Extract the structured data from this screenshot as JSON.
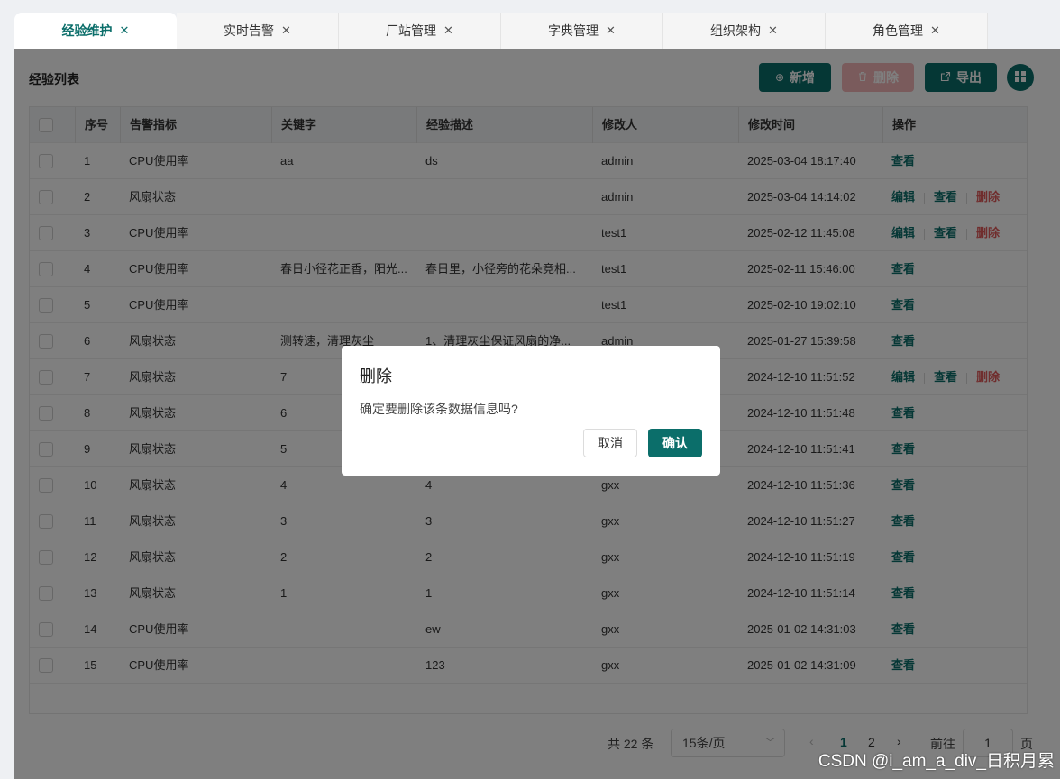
{
  "tabs": [
    {
      "label": "经验维护",
      "active": true
    },
    {
      "label": "实时告警"
    },
    {
      "label": "厂站管理"
    },
    {
      "label": "字典管理"
    },
    {
      "label": "组织架构"
    },
    {
      "label": "角色管理"
    }
  ],
  "close_glyph": "✕",
  "panel": {
    "title": "经验列表"
  },
  "toolbar": {
    "add_label": "新增",
    "delete_label": "删除",
    "export_label": "导出"
  },
  "table": {
    "headers": [
      "序号",
      "告警指标",
      "关键字",
      "经验描述",
      "修改人",
      "修改时间",
      "操作"
    ],
    "ops": {
      "view": "查看",
      "edit": "编辑",
      "delete": "删除"
    },
    "rows": [
      {
        "no": "1",
        "metric": "CPU使用率",
        "keyword": "aa",
        "desc": "ds",
        "user": "admin",
        "time": "2025-03-04 18:17:40",
        "editable": false
      },
      {
        "no": "2",
        "metric": "风扇状态",
        "keyword": "",
        "desc": "",
        "user": "admin",
        "time": "2025-03-04 14:14:02",
        "editable": true
      },
      {
        "no": "3",
        "metric": "CPU使用率",
        "keyword": "",
        "desc": "",
        "user": "test1",
        "time": "2025-02-12 11:45:08",
        "editable": true
      },
      {
        "no": "4",
        "metric": "CPU使用率",
        "keyword": "春日小径花正香，阳光...",
        "desc": "春日里，小径旁的花朵竞相...",
        "user": "test1",
        "time": "2025-02-11 15:46:00",
        "editable": false
      },
      {
        "no": "5",
        "metric": "CPU使用率",
        "keyword": "",
        "desc": "",
        "user": "test1",
        "time": "2025-02-10 19:02:10",
        "editable": false
      },
      {
        "no": "6",
        "metric": "风扇状态",
        "keyword": "测转速，清理灰尘",
        "desc": "1、清理灰尘保证风扇的净...",
        "user": "admin",
        "time": "2025-01-27 15:39:58",
        "editable": false
      },
      {
        "no": "7",
        "metric": "风扇状态",
        "keyword": "7",
        "desc": "",
        "user": "",
        "time": "2024-12-10 11:51:52",
        "editable": true
      },
      {
        "no": "8",
        "metric": "风扇状态",
        "keyword": "6",
        "desc": "",
        "user": "",
        "time": "2024-12-10 11:51:48",
        "editable": false
      },
      {
        "no": "9",
        "metric": "风扇状态",
        "keyword": "5",
        "desc": "",
        "user": "",
        "time": "2024-12-10 11:51:41",
        "editable": false
      },
      {
        "no": "10",
        "metric": "风扇状态",
        "keyword": "4",
        "desc": "4",
        "user": "gxx",
        "time": "2024-12-10 11:51:36",
        "editable": false
      },
      {
        "no": "11",
        "metric": "风扇状态",
        "keyword": "3",
        "desc": "3",
        "user": "gxx",
        "time": "2024-12-10 11:51:27",
        "editable": false
      },
      {
        "no": "12",
        "metric": "风扇状态",
        "keyword": "2",
        "desc": "2",
        "user": "gxx",
        "time": "2024-12-10 11:51:19",
        "editable": false
      },
      {
        "no": "13",
        "metric": "风扇状态",
        "keyword": "1",
        "desc": "1",
        "user": "gxx",
        "time": "2024-12-10 11:51:14",
        "editable": false
      },
      {
        "no": "14",
        "metric": "CPU使用率",
        "keyword": "",
        "desc": "ew",
        "user": "gxx",
        "time": "2025-01-02 14:31:03",
        "editable": false
      },
      {
        "no": "15",
        "metric": "CPU使用率",
        "keyword": "",
        "desc": "123",
        "user": "gxx",
        "time": "2025-01-02 14:31:09",
        "editable": false
      }
    ]
  },
  "pagination": {
    "total_label": "共 22 条",
    "page_size": "15条/页",
    "pages": [
      "1",
      "2"
    ],
    "current_page": "1",
    "goto_label": "前往",
    "goto_value": "1",
    "page_unit": "页"
  },
  "dialog": {
    "title": "删除",
    "message": "确定要删除该条数据信息吗?",
    "cancel_label": "取消",
    "confirm_label": "确认"
  },
  "watermark": "CSDN @i_am_a_div_日积月累",
  "colors": {
    "primary": "#0b6e6a",
    "danger": "#e05a5a",
    "danger_disabled": "#f4b7b9"
  }
}
